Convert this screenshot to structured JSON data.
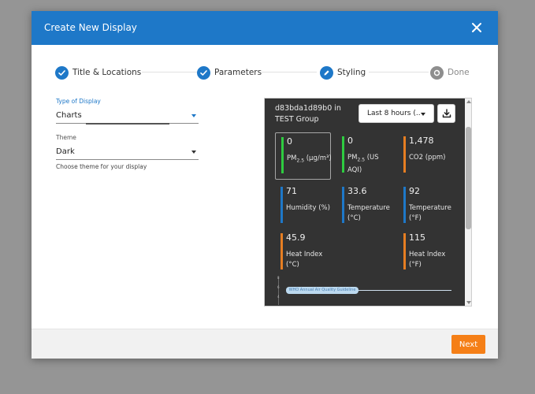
{
  "dialog": {
    "title": "Create New Display",
    "next_label": "Next"
  },
  "steps": [
    {
      "label": "Title & Locations",
      "state": "complete"
    },
    {
      "label": "Parameters",
      "state": "complete"
    },
    {
      "label": "Styling",
      "state": "current"
    },
    {
      "label": "Done",
      "state": "pending"
    }
  ],
  "form": {
    "display_type": {
      "label": "Type of Display",
      "value": "Charts"
    },
    "theme": {
      "label": "Theme",
      "value": "Dark",
      "helper": "Choose theme for your display"
    }
  },
  "preview": {
    "title": "d83bda1d89b0 in TEST Group",
    "time_range": "Last 8 hours (..",
    "tiles": [
      {
        "value": "0",
        "label": "PM",
        "sub": "2.5",
        "suffix": "(μg/m³)",
        "color": "#2ecc40"
      },
      {
        "value": "0",
        "label": "PM",
        "sub": "2.5",
        "suffix": "(US AQI)",
        "color": "#2ecc40"
      },
      {
        "value": "1,478",
        "label": "CO2 (ppm)",
        "color": "#e67e22"
      },
      {
        "value": "71",
        "label": "Humidity (%)",
        "color": "#1e78c8"
      },
      {
        "value": "33.6",
        "label": "Temperature (°C)",
        "color": "#1e78c8"
      },
      {
        "value": "92",
        "label": "Temperature (°F)",
        "color": "#1e78c8"
      },
      {
        "value": "45.9",
        "label": "Heat Index (°C)",
        "color": "#e67e22"
      },
      {
        "value": "115",
        "label": "Heat Index (°F)",
        "color": "#e67e22"
      }
    ],
    "chart": {
      "ticks": [
        "8",
        "6",
        "4"
      ],
      "guideline_label": "WHO Annual Air Quality Guideline"
    }
  },
  "colors": {
    "header": "#1e78c8",
    "accent": "#1e78c8",
    "next_button": "#f57f17"
  }
}
